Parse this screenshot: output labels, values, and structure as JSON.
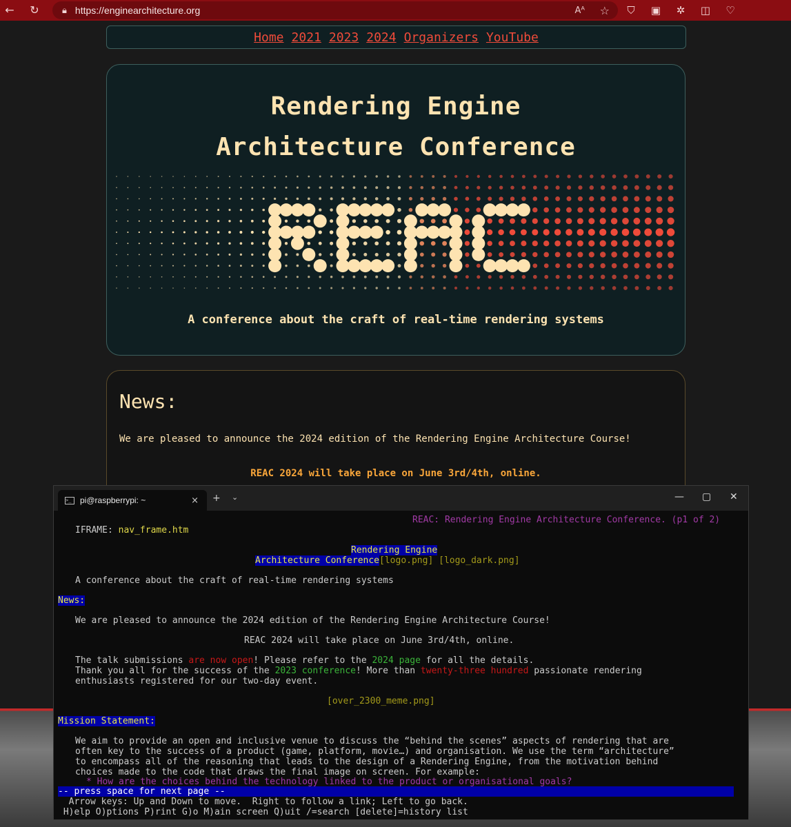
{
  "browser": {
    "url": "https://enginearchitecture.org",
    "read_aloud": "Aᴬ",
    "icons": [
      "back-icon",
      "refresh-icon",
      "lock-icon",
      "read-aloud-icon",
      "favorite-star-icon",
      "shield-icon",
      "save-icon",
      "extension-icon",
      "split-screen-icon",
      "heart-pulse-icon"
    ]
  },
  "nav": {
    "links": [
      "Home",
      "2021",
      "2023",
      "2024",
      "Organizers",
      "YouTube"
    ]
  },
  "hero": {
    "title_line1": "Rendering Engine",
    "title_line2": "Architecture Conference",
    "logo_text": "REAC",
    "tagline": "A conference about the craft of real-time rendering systems"
  },
  "news": {
    "heading": "News:",
    "announcement": "We are pleased to announce the 2024 edition of the Rendering Engine Architecture Course!",
    "event": "REAC 2024 will take place on June 3rd/4th, online."
  },
  "terminal": {
    "tab_title": "pi@raspberrypi: ~",
    "tab_close": "×",
    "new_tab": "+",
    "dropdown": "⌄",
    "minimize": "—",
    "maximize": "▢",
    "close": "✕",
    "header": "REAC: Rendering Engine Architecture Conference. (p1 of 2)",
    "iframe_label": "IFRAME: ",
    "iframe_link": "nav_frame.htm",
    "title1": "Rendering Engine",
    "title2": "Architecture Conference",
    "img_logo": "[logo.png]",
    "img_logo_dark": "[logo_dark.png]",
    "tagline": "A conference about the craft of real-time rendering systems",
    "news_heading": "News:",
    "announcement": "We are pleased to announce the 2024 edition of the Rendering Engine Architecture Course!",
    "event": "REAC 2024 will take place on June 3rd/4th, online.",
    "sub_a": "The talk submissions ",
    "sub_link1": "are now open",
    "sub_b": "! Please refer to the ",
    "sub_link2": "2024 page",
    "sub_c": " for all the details.",
    "thanks_a": "Thank you all for the success of the ",
    "thanks_link1": "2023 conference",
    "thanks_b": "! More than ",
    "thanks_link2": "twenty-three hundred",
    "thanks_c": " passionate rendering",
    "thanks_d": "enthusiasts registered for our two-day event.",
    "meme_img": "[over_2300_meme.png]",
    "mission_heading": "Mission Statement:",
    "mission_1": "We aim to provide an open and inclusive venue to discuss the “behind the scenes” aspects of rendering that are",
    "mission_2": "often key to the success of a product (game, platform, movie…) and organisation. We use the term “architecture”",
    "mission_3": "to encompass all of the reasoning that leads to the design of a Rendering Engine, from the motivation behind",
    "mission_4": "choices made to the code that draws the final image on screen. For example:",
    "bullet": "* How are the choices behind the technology linked to the product or organisational goals?",
    "status": "-- press space for next page --",
    "help1": "  Arrow keys: Up and Down to move.  Right to follow a link; Left to go back.",
    "help2": " H)elp O)ptions P)rint G)o M)ain screen Q)uit /=search [delete]=history list"
  }
}
